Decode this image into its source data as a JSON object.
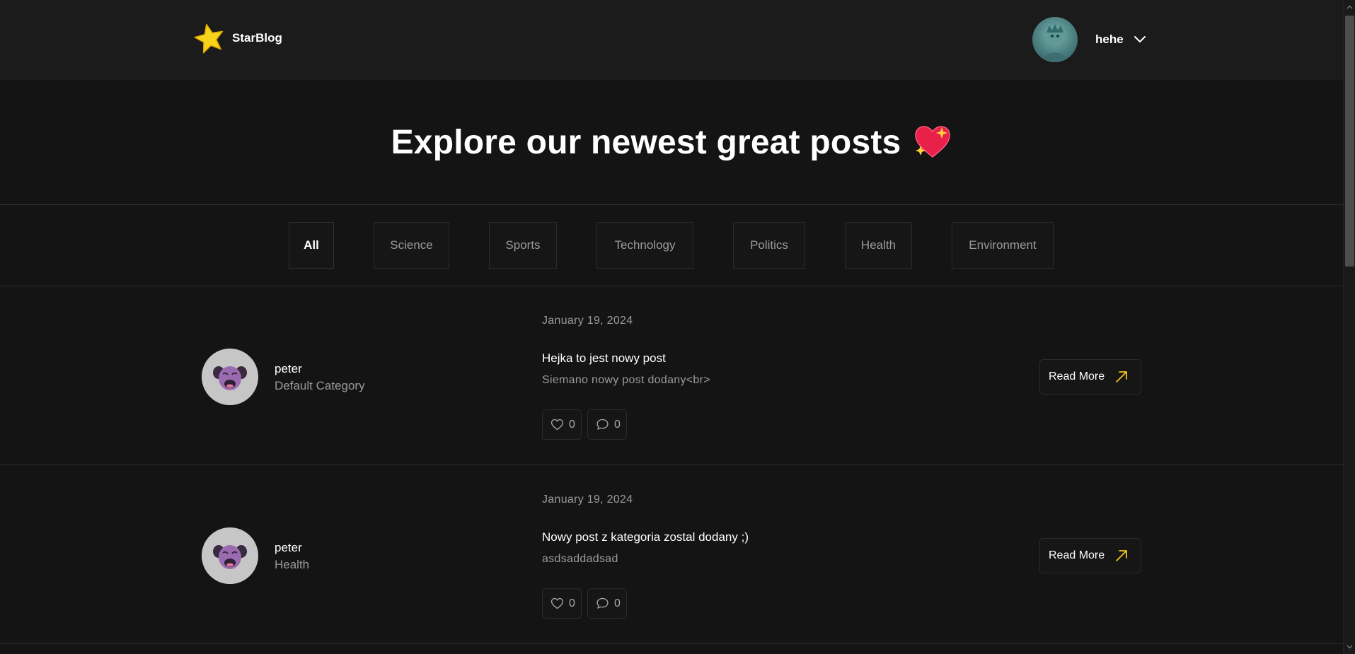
{
  "header": {
    "logo_text": "StarBlog",
    "user_name": "hehe"
  },
  "hero": {
    "title": "Explore our newest great posts"
  },
  "categories": [
    {
      "label": "All",
      "active": true
    },
    {
      "label": "Science",
      "active": false
    },
    {
      "label": "Sports",
      "active": false
    },
    {
      "label": "Technology",
      "active": false
    },
    {
      "label": "Politics",
      "active": false
    },
    {
      "label": "Health",
      "active": false
    },
    {
      "label": "Environment",
      "active": false
    }
  ],
  "posts": [
    {
      "author": "peter",
      "category": "Default Category",
      "date": "January 19, 2024",
      "title": "Hejka to jest nowy post",
      "excerpt": "Siemano nowy post dodany<br>",
      "likes": "0",
      "comments": "0",
      "read_more_label": "Read More"
    },
    {
      "author": "peter",
      "category": "Health",
      "date": "January 19, 2024",
      "title": "Nowy post z kategoria zostal dodany ;)",
      "excerpt": "asdsaddadsad",
      "likes": "0",
      "comments": "0",
      "read_more_label": "Read More"
    }
  ],
  "icons": {
    "logo": "star-icon",
    "user_menu": "chevron-down-icon",
    "hero": "sparkling-heart-icon",
    "like": "heart-icon",
    "comment": "comment-bubble-icon",
    "read_more": "arrow-up-right-icon"
  },
  "colors": {
    "background": "#141414",
    "header_background": "#1b1b1b",
    "accent": "#f5c518",
    "muted_text": "#9a9a9a",
    "divider": "#26323a"
  }
}
